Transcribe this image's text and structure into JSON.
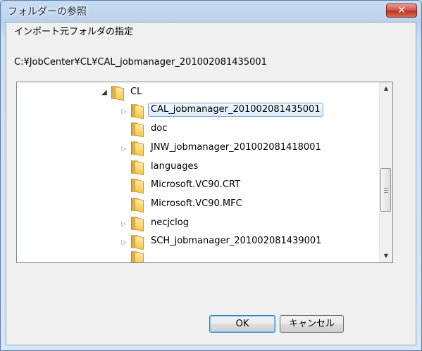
{
  "window": {
    "title": "フォルダーの参照",
    "close_symbol": "✕"
  },
  "dialog": {
    "instruction": "インポート元フォルダの指定",
    "selected_path": "C:¥JobCenter¥CL¥CAL_jobmanager_201002081435001"
  },
  "tree": {
    "items": [
      {
        "label": "CL",
        "expander": "◢",
        "state": "expanded"
      },
      {
        "label": "CAL_jobmanager_201002081435001",
        "expander": "▷",
        "state": "collapsed",
        "selected": true
      },
      {
        "label": "doc",
        "expander": "",
        "state": "leaf"
      },
      {
        "label": "JNW_jobmanager_201002081418001",
        "expander": "▷",
        "state": "collapsed"
      },
      {
        "label": "languages",
        "expander": "",
        "state": "leaf"
      },
      {
        "label": "Microsoft.VC90.CRT",
        "expander": "",
        "state": "leaf"
      },
      {
        "label": "Microsoft.VC90.MFC",
        "expander": "",
        "state": "leaf"
      },
      {
        "label": "necjclog",
        "expander": "▷",
        "state": "collapsed"
      },
      {
        "label": "SCH_jobmanager_201002081439001",
        "expander": "▷",
        "state": "collapsed"
      }
    ],
    "scroll": {
      "up_symbol": "▲",
      "down_symbol": "▼"
    }
  },
  "buttons": {
    "ok_label": "OK",
    "cancel_label": "キャンセル"
  },
  "icons": [
    "close-icon",
    "folder-icon",
    "tree-expander-icon",
    "scroll-up-icon",
    "scroll-down-icon"
  ]
}
